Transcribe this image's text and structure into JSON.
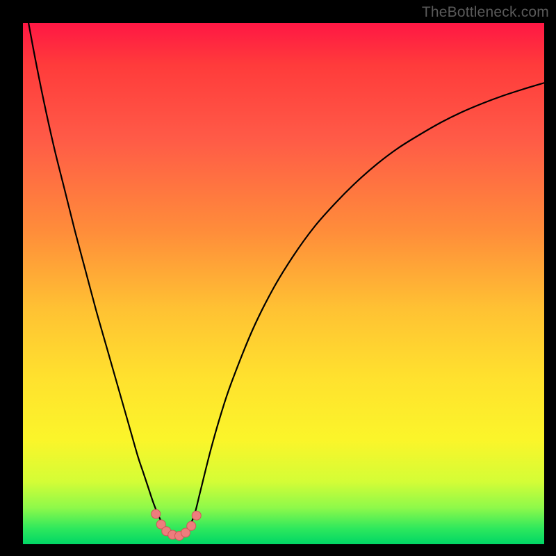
{
  "watermark": "TheBottleneck.com",
  "colors": {
    "frame": "#000000",
    "gradient_top": "#ff1744",
    "gradient_bottom": "#00d665",
    "curve": "#000000",
    "marker_fill": "#ee7d7d",
    "marker_stroke": "#d05858"
  },
  "chart_data": {
    "type": "line",
    "title": "",
    "xlabel": "",
    "ylabel": "",
    "xlim": [
      0,
      100
    ],
    "ylim": [
      0,
      100
    ],
    "grid": false,
    "legend": false,
    "series": [
      {
        "name": "bottleneck-curve",
        "x": [
          0,
          2,
          4,
          6,
          8,
          10,
          12,
          14,
          16,
          18,
          20,
          22,
          23,
          24,
          25,
          26,
          27,
          28,
          29,
          30,
          31,
          32,
          33,
          34,
          36,
          38,
          40,
          44,
          48,
          52,
          56,
          60,
          64,
          68,
          72,
          76,
          80,
          84,
          88,
          92,
          96,
          100
        ],
        "y": [
          106,
          95,
          85,
          76,
          68,
          60,
          52.5,
          45,
          38,
          31,
          24,
          17,
          14,
          11,
          8,
          5.5,
          3.5,
          2.3,
          1.6,
          1.5,
          2,
          3.5,
          6,
          10,
          18,
          25,
          31,
          41,
          49,
          55.5,
          61,
          65.5,
          69.5,
          73,
          76,
          78.5,
          80.8,
          82.8,
          84.5,
          86,
          87.3,
          88.5
        ]
      }
    ],
    "markers": [
      {
        "x": 25.5,
        "y": 5.8
      },
      {
        "x": 26.5,
        "y": 3.8
      },
      {
        "x": 27.5,
        "y": 2.5
      },
      {
        "x": 28.7,
        "y": 1.8
      },
      {
        "x": 30.0,
        "y": 1.6
      },
      {
        "x": 31.2,
        "y": 2.2
      },
      {
        "x": 32.3,
        "y": 3.5
      },
      {
        "x": 33.3,
        "y": 5.5
      }
    ]
  }
}
